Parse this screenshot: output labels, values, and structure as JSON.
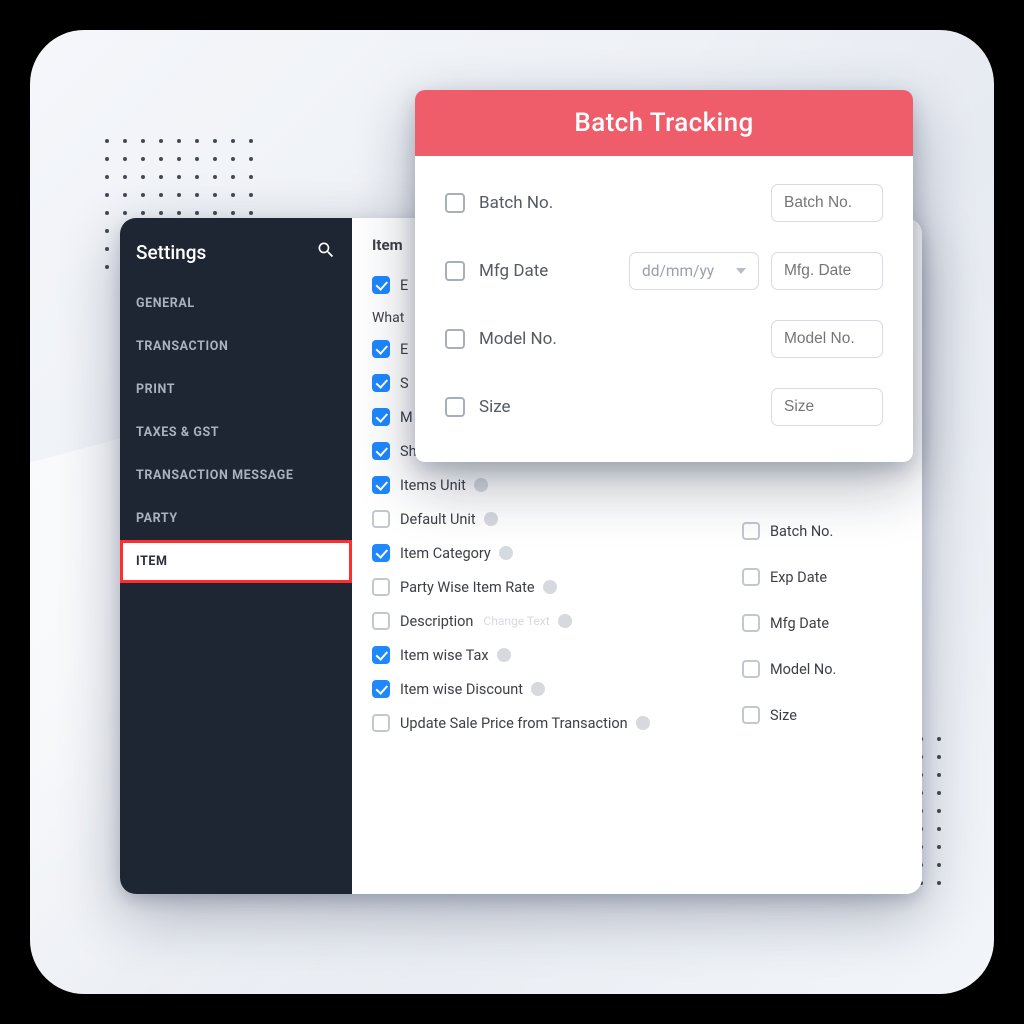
{
  "colors": {
    "accent_blue": "#1e88ff",
    "popup_red": "#ef5d6b",
    "highlight_border": "#ff2d2d",
    "sidebar_bg": "#1e2633"
  },
  "sidebar": {
    "title": "Settings",
    "items": [
      {
        "label": "GENERAL"
      },
      {
        "label": "TRANSACTION"
      },
      {
        "label": "PRINT"
      },
      {
        "label": "TAXES & GST"
      },
      {
        "label": "TRANSACTION MESSAGE"
      },
      {
        "label": "PARTY"
      },
      {
        "label": "ITEM",
        "active": true
      }
    ]
  },
  "content": {
    "section_title_prefix": "Item",
    "sub_heading_prefix": "What",
    "options": [
      {
        "label": "E",
        "checked": true,
        "obscured": true
      },
      {
        "label": "E",
        "checked": true,
        "obscured": true
      },
      {
        "label": "S",
        "checked": true,
        "obscured": true
      },
      {
        "label": "M",
        "checked": true,
        "obscured": true
      },
      {
        "label": "Show Low Stock Dialog",
        "checked": true,
        "info": true
      },
      {
        "label": "Items Unit",
        "checked": true,
        "info": true
      },
      {
        "label": "Default Unit",
        "checked": false,
        "info": true
      },
      {
        "label": "Item Category",
        "checked": true,
        "info": true
      },
      {
        "label": "Party Wise Item Rate",
        "checked": false,
        "info": true
      },
      {
        "label": "Description",
        "checked": false,
        "info": true,
        "change_text": "Change Text"
      },
      {
        "label": "Item wise Tax",
        "checked": true,
        "info": true
      },
      {
        "label": "Item wise Discount",
        "checked": true,
        "info": true
      },
      {
        "label": "Update Sale Price from Transaction",
        "checked": false,
        "info": true
      }
    ],
    "right_options": [
      {
        "label": "Batch No."
      },
      {
        "label": "Exp Date"
      },
      {
        "label": "Mfg Date"
      },
      {
        "label": "Model No."
      },
      {
        "label": "Size"
      }
    ]
  },
  "popup": {
    "title": "Batch Tracking",
    "rows": [
      {
        "label": "Batch No.",
        "placeholder": "Batch No."
      },
      {
        "label": "Mfg Date",
        "select_placeholder": "dd/mm/yy",
        "placeholder": "Mfg. Date"
      },
      {
        "label": "Model No.",
        "placeholder": "Model No."
      },
      {
        "label": "Size",
        "placeholder": "Size"
      }
    ]
  }
}
